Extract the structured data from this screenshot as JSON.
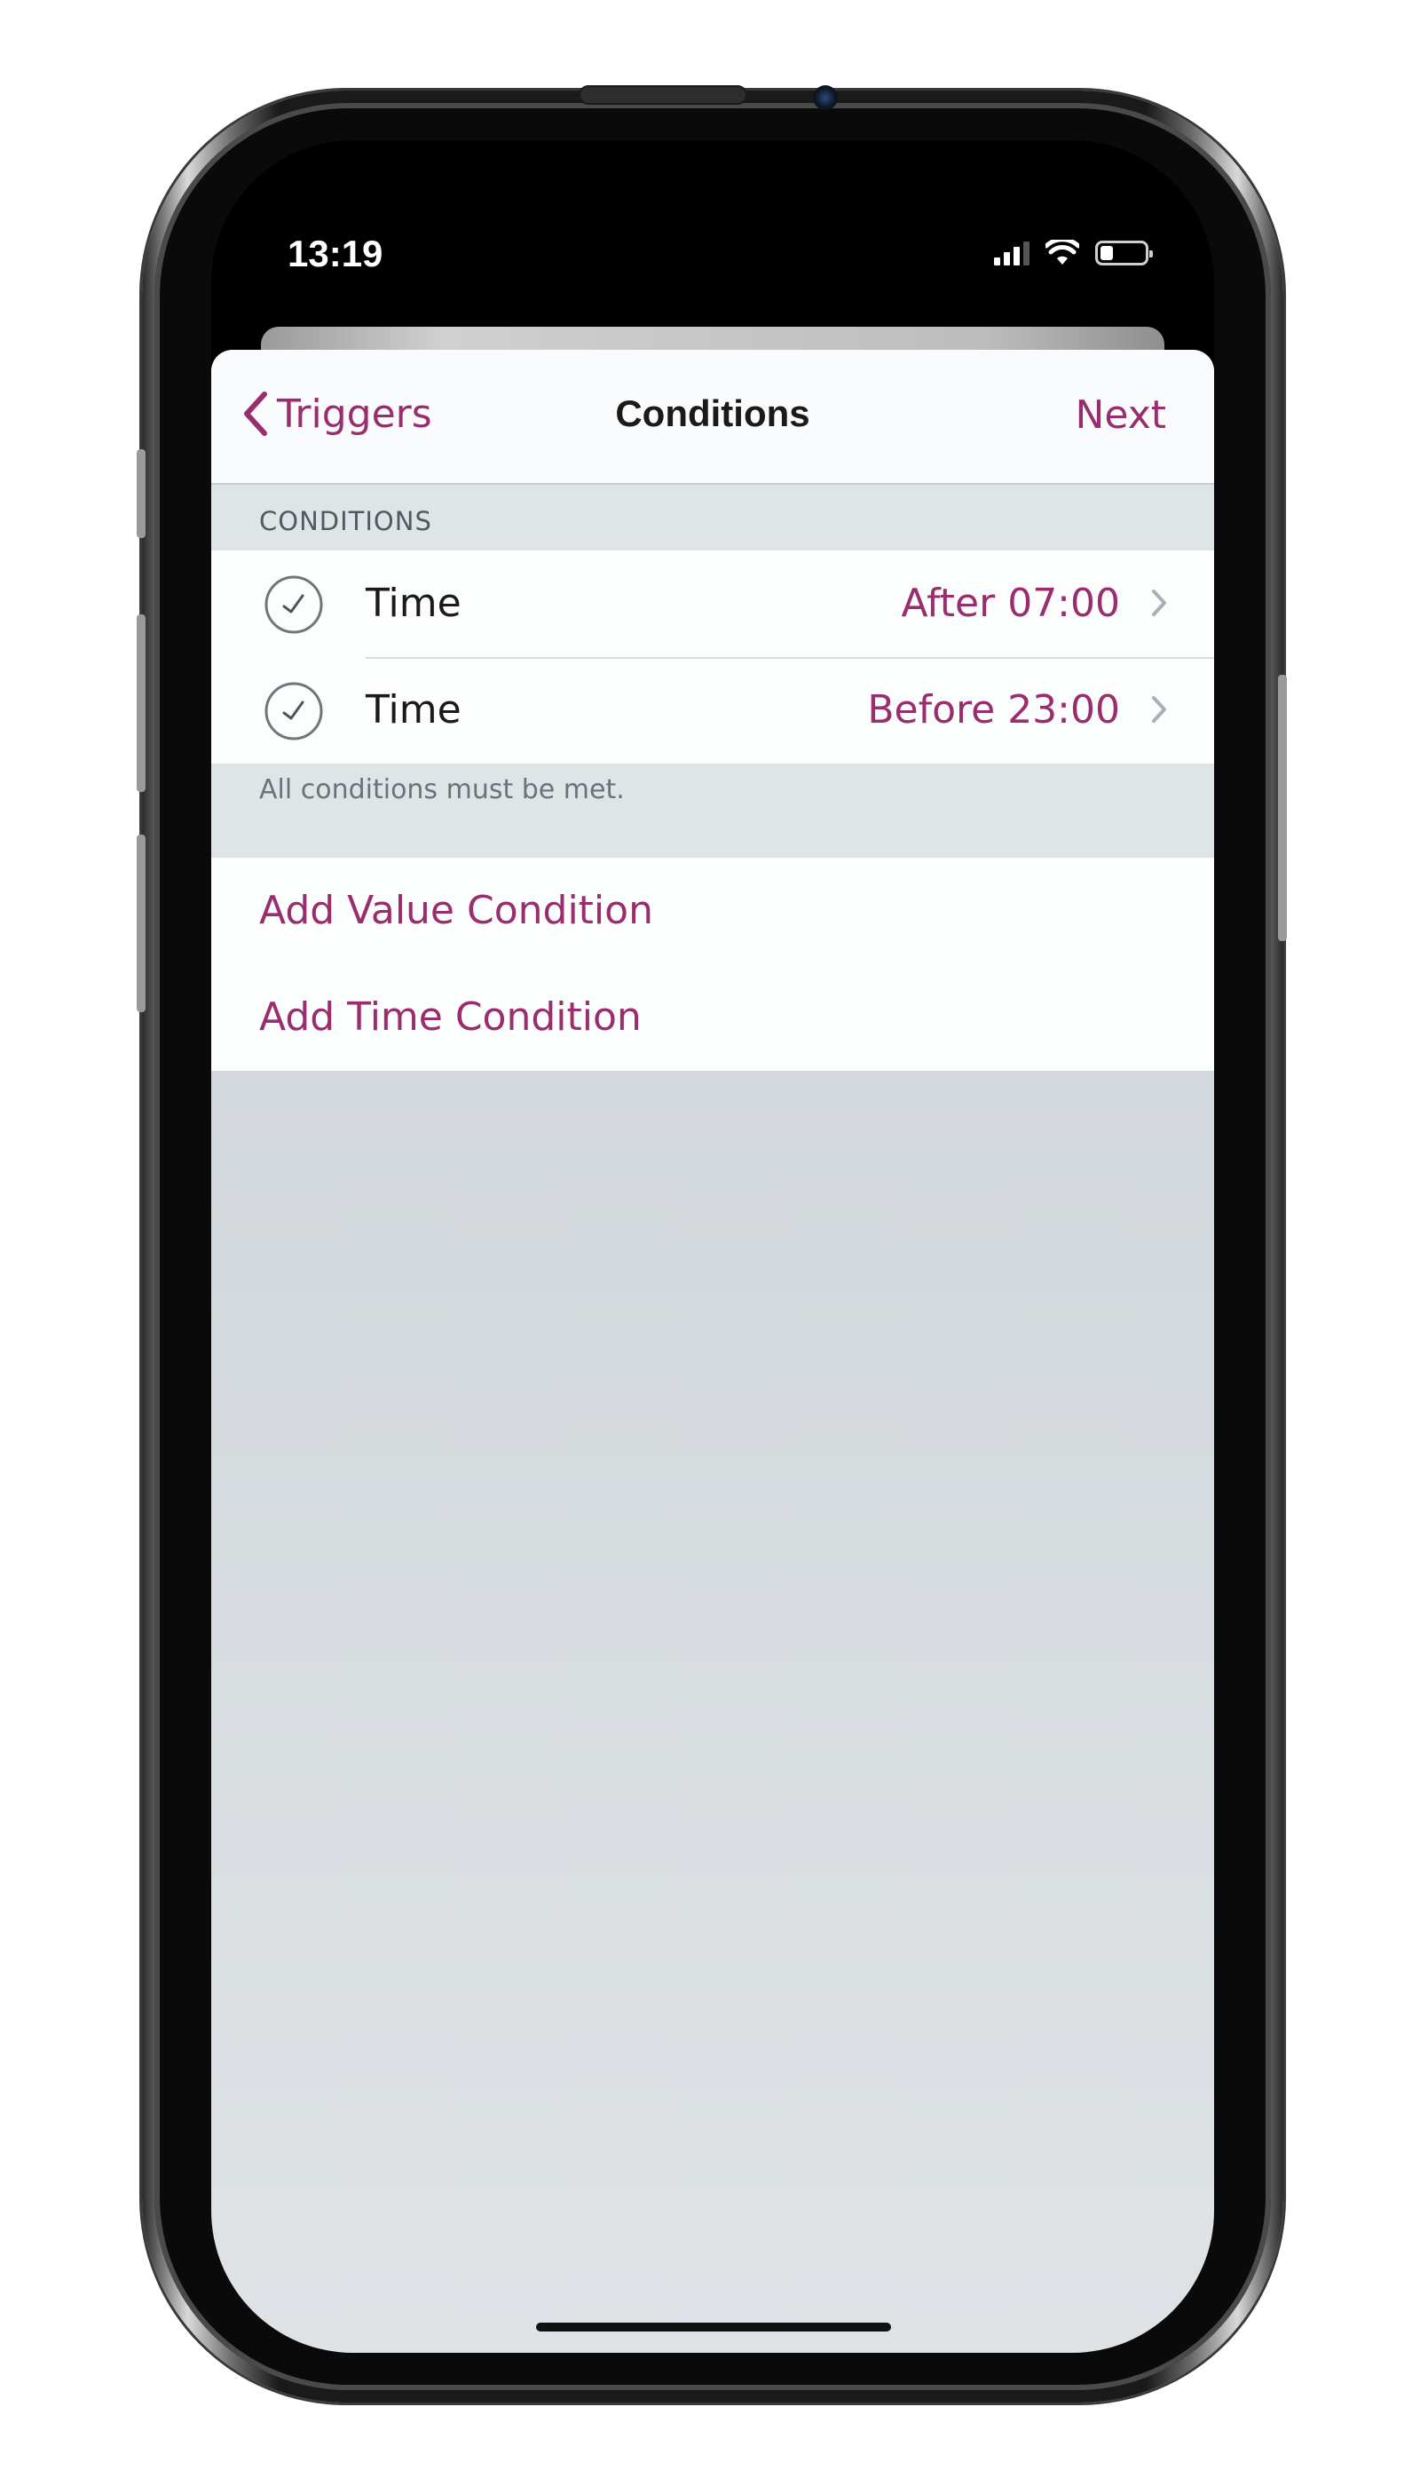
{
  "status_bar": {
    "time": "13:19",
    "icons": [
      "cellular-signal-icon",
      "wifi-icon",
      "battery-icon"
    ]
  },
  "navbar": {
    "back_label": "Triggers",
    "title": "Conditions",
    "next_label": "Next"
  },
  "conditions": {
    "section_header": "CONDITIONS",
    "items": [
      {
        "icon": "clock-icon",
        "label": "Time",
        "value": "After 07:00"
      },
      {
        "icon": "clock-icon",
        "label": "Time",
        "value": "Before 23:00"
      }
    ],
    "footer": "All conditions must be met."
  },
  "actions": {
    "add_value": "Add Value Condition",
    "add_time": "Add Time Condition"
  },
  "colors": {
    "accent": "#9a2d6d",
    "background": "#dfe4e7",
    "cell": "#fcfdfd"
  }
}
